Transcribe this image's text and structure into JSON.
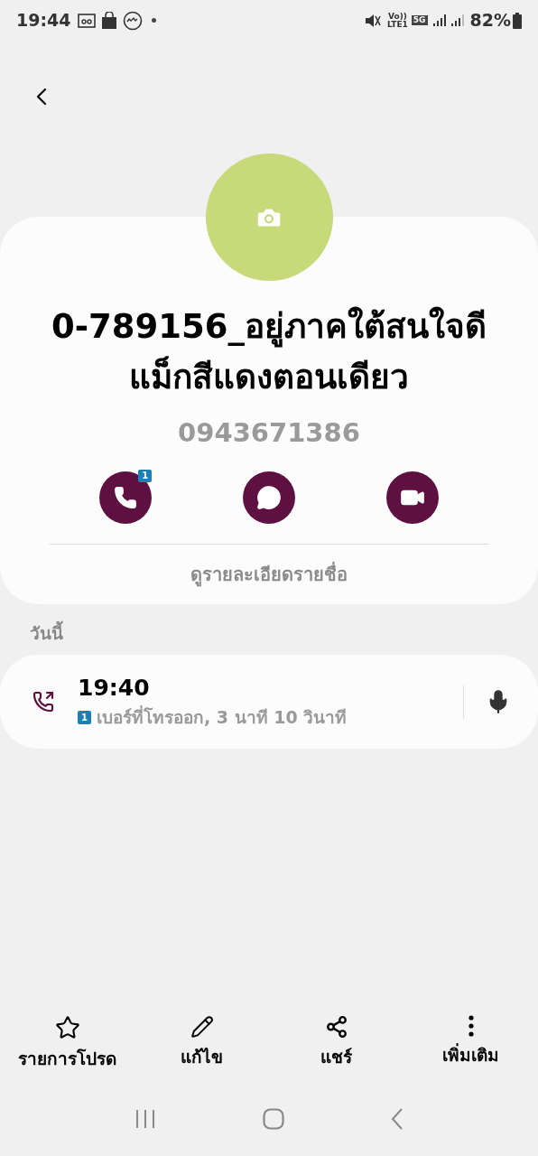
{
  "status_bar": {
    "time": "19:44",
    "volte": "Vo))",
    "lte": "LTE1",
    "network": "5G",
    "battery": "82%"
  },
  "contact": {
    "name_lines": [
      "0-789156_อยู่ภาคใต้สนใจดี",
      "แม็กสีแดงตอนเดียว"
    ],
    "phone": "0943671386"
  },
  "actions": [
    {
      "kind": "call",
      "badge": "1"
    },
    {
      "kind": "message"
    },
    {
      "kind": "video"
    }
  ],
  "details_link": "ดูรายละเอียดรายชื่อ",
  "section_title": "วันนี้",
  "call_log": [
    {
      "display_time": "19:40",
      "sim": "1",
      "description": "เบอร์ที่โทรออก, 3 นาที 10 วินาที"
    }
  ],
  "bottom_bar": [
    {
      "kind": "star",
      "label": "รายการโปรด"
    },
    {
      "kind": "edit",
      "label": "แก้ไข"
    },
    {
      "kind": "share",
      "label": "แชร์"
    },
    {
      "kind": "more",
      "label": "เพิ่มเติม"
    }
  ]
}
